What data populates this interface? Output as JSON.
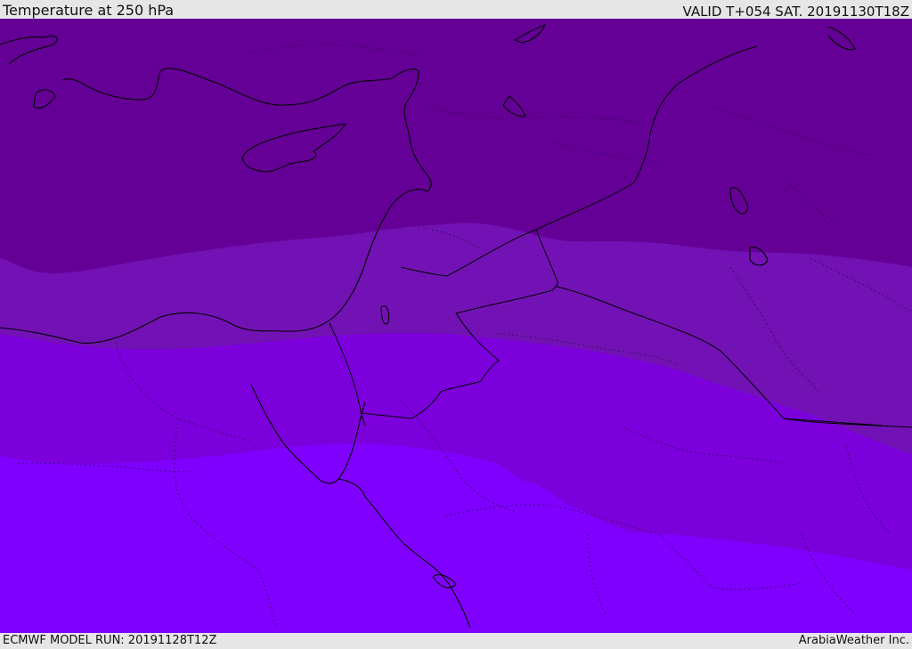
{
  "header": {
    "title": "Temperature at 250 hPa",
    "valid_time": "VALID T+054 SAT. 20191130T18Z"
  },
  "footer": {
    "model_run": "ECMWF MODEL RUN: 20191128T12Z",
    "provider": "ArabiaWeather Inc."
  },
  "colors": {
    "band_coldest": "#640096",
    "band_cold": "#7212b4",
    "band_mid": "#7b00dc",
    "band_warm": "#8000ff",
    "bar_background": "#e6e6e6"
  }
}
